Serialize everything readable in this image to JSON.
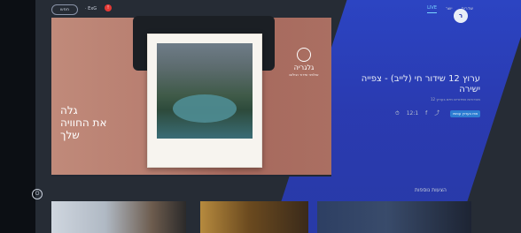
{
  "topbar": {
    "search_label": "חפש",
    "language_label": "· ExG",
    "live_badge": "!",
    "nav": [
      "LIVE",
      "ישר",
      "שדרים"
    ]
  },
  "logo": {
    "text": "ר"
  },
  "player": {
    "left_text": "גלה\nאת החוויה\nשלך",
    "brand_title": "גלגריה",
    "brand_sub": "אולפני שידור וצילום"
  },
  "right": {
    "title": "ערוץ 12 שידור חי (לייב) - צפייה ישירה",
    "subtitle": "מהדורות ושידורים חיים בערוץ 12",
    "meta": {
      "views": "12:1",
      "share": "f",
      "badge": "צפו בערוץ עכשיו"
    }
  },
  "section": {
    "title": "הצעות נוספות"
  },
  "icons": {
    "search-icon": "⌕",
    "live-icon": "●",
    "share-icon": "⤴",
    "facebook-icon": "f",
    "clock-icon": "⏱",
    "circle-icon": "⭘"
  },
  "colors": {
    "accent": "#2a3bb3",
    "badge": "#2d7dd2",
    "live": "#e53935"
  }
}
